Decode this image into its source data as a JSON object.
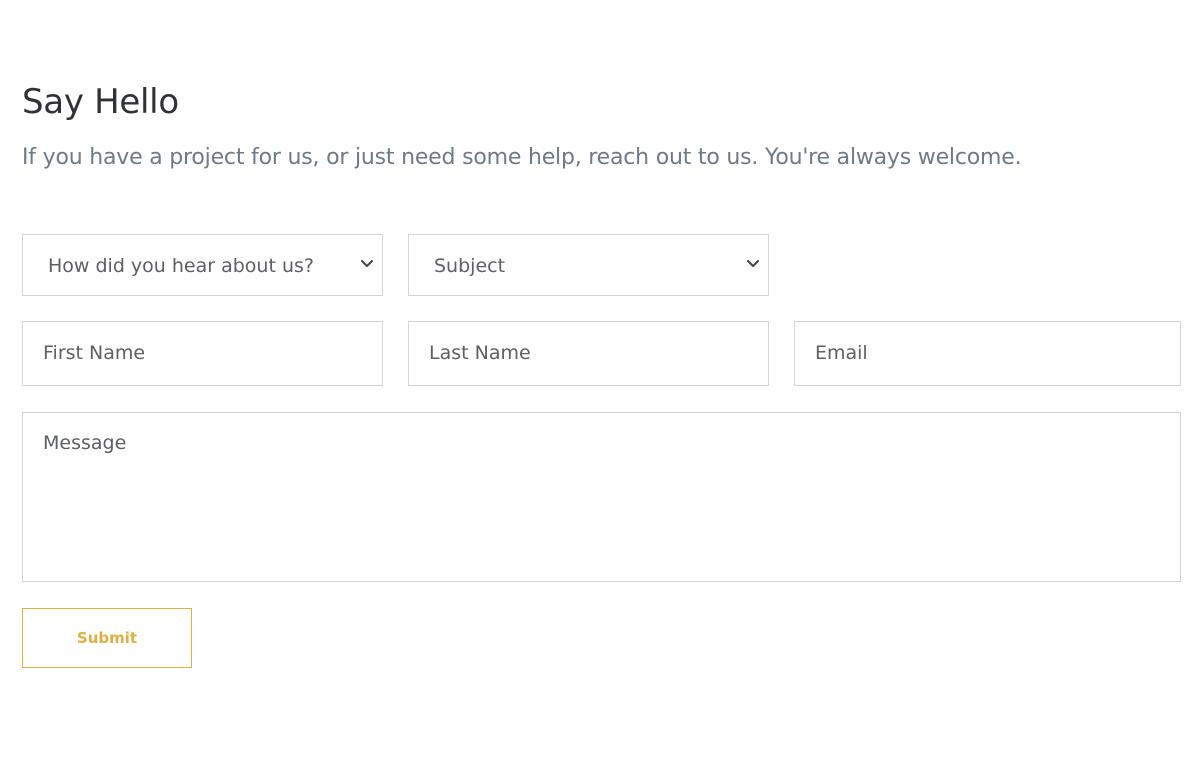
{
  "page": {
    "title": "Say Hello",
    "subtitle": "If you have a project for us, or just need some help, reach out to us. You're always welcome."
  },
  "form": {
    "referral_select": {
      "value": "How did you hear about us?",
      "icon": "chevron-down-icon"
    },
    "subject_select": {
      "value": "Subject",
      "icon": "chevron-down-icon"
    },
    "first_name": {
      "placeholder": "First Name",
      "value": ""
    },
    "last_name": {
      "placeholder": "Last Name",
      "value": ""
    },
    "email": {
      "placeholder": "Email",
      "value": ""
    },
    "message": {
      "placeholder": "Message",
      "value": ""
    },
    "submit_label": "Submit"
  },
  "colors": {
    "heading": "#303236",
    "subtitle": "#6f7a87",
    "field_border": "#d2d4d7",
    "placeholder_text": "#5c5f63",
    "accent": "#e0b33f"
  }
}
